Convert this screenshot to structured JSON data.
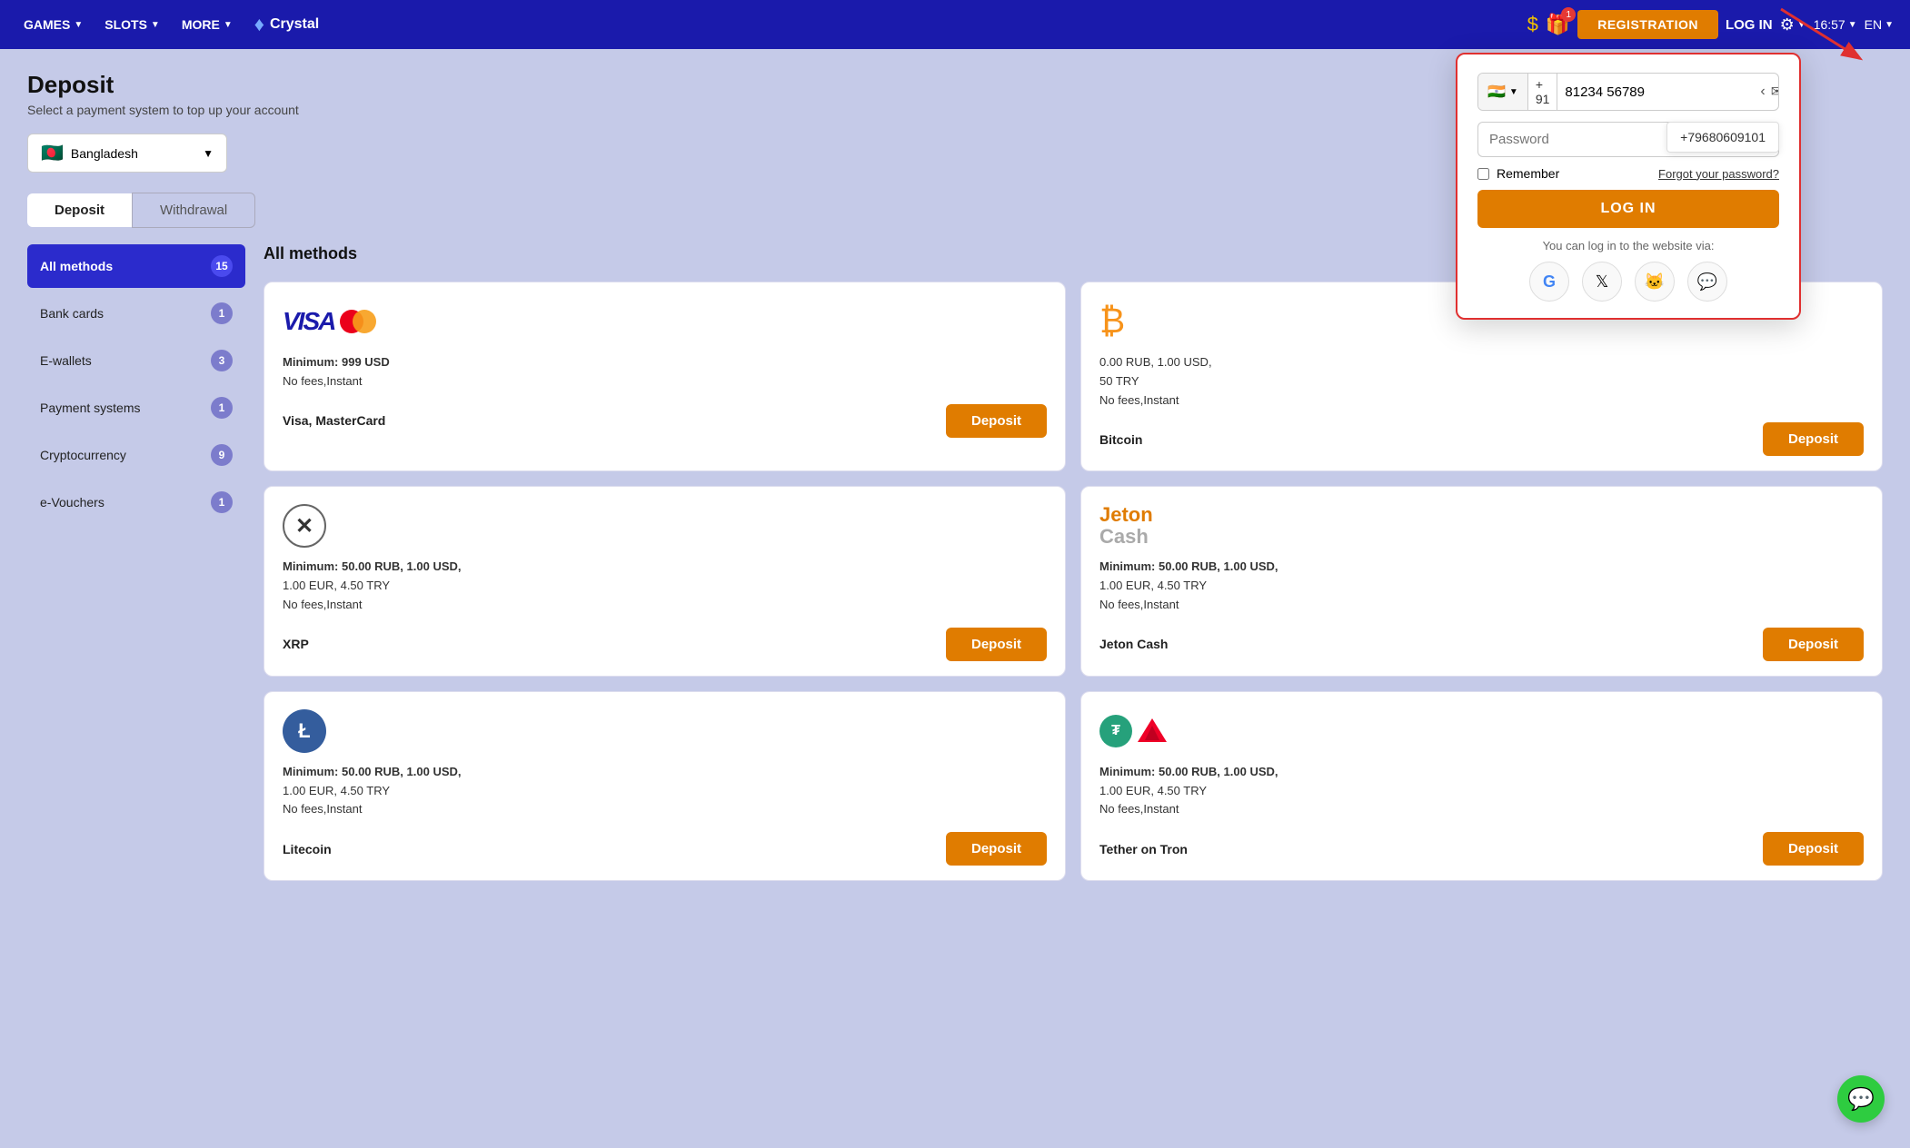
{
  "navbar": {
    "games_label": "GAMES",
    "slots_label": "SLOTS",
    "more_label": "MORE",
    "logo_icon": "♦",
    "logo_name": "Crystal",
    "registration_label": "REGISTRATION",
    "login_label": "LOG IN",
    "time": "16:57",
    "lang": "EN",
    "gift_badge": "1"
  },
  "page": {
    "title": "Deposit",
    "subtitle": "Select a payment system to top up your account",
    "country": "Bangladesh",
    "country_flag": "🇧🇩",
    "tab_deposit": "Deposit",
    "tab_withdrawal": "Withdrawal"
  },
  "sidebar": {
    "items": [
      {
        "id": "all-methods",
        "label": "All methods",
        "count": "15",
        "active": true
      },
      {
        "id": "bank-cards",
        "label": "Bank cards",
        "count": "1",
        "active": false
      },
      {
        "id": "e-wallets",
        "label": "E-wallets",
        "count": "3",
        "active": false
      },
      {
        "id": "payment-systems",
        "label": "Payment systems",
        "count": "1",
        "active": false
      },
      {
        "id": "cryptocurrency",
        "label": "Cryptocurrency",
        "count": "9",
        "active": false
      },
      {
        "id": "e-vouchers",
        "label": "e-Vouchers",
        "count": "1",
        "active": false
      }
    ]
  },
  "payment_section_title": "All methods",
  "payment_methods": [
    {
      "id": "visa-mastercard",
      "name": "Visa, MasterCard",
      "min": "Minimum: 999 USD",
      "fees": "No fees,Instant",
      "extra": "",
      "deposit_label": "Deposit"
    },
    {
      "id": "bitcoin",
      "name": "Bitcoin",
      "min": "0.00 RUB, 1.00 USD,",
      "fees": "No fees,Instant",
      "extra": "50 TRY",
      "deposit_label": "Deposit"
    },
    {
      "id": "xrp",
      "name": "XRP",
      "min": "Minimum: 50.00 RUB, 1.00 USD,",
      "fees": "No fees,Instant",
      "extra": "1.00 EUR, 4.50 TRY",
      "deposit_label": "Deposit"
    },
    {
      "id": "jeton-cash",
      "name": "Jeton Cash",
      "min": "Minimum: 50.00 RUB, 1.00 USD,",
      "fees": "No fees,Instant",
      "extra": "1.00 EUR, 4.50 TRY",
      "deposit_label": "Deposit"
    },
    {
      "id": "litecoin",
      "name": "Litecoin",
      "min": "Minimum: 50.00 RUB, 1.00 USD,",
      "fees": "No fees,Instant",
      "extra": "1.00 EUR, 4.50 TRY",
      "deposit_label": "Deposit"
    },
    {
      "id": "tether-on-tron",
      "name": "Tether on Tron",
      "min": "Minimum: 50.00 RUB, 1.00 USD,",
      "fees": "No fees,Instant",
      "extra": "1.00 EUR, 4.50 TRY",
      "deposit_label": "Deposit"
    }
  ],
  "login_modal": {
    "phone_flag": "🇮🇳",
    "phone_code": "+ 91",
    "phone_value": "81234 56789",
    "suggestion": "+79680609101",
    "password_placeholder": "Password",
    "remember_label": "Remember",
    "forgot_label": "Forgot your password?",
    "login_button": "LOG IN",
    "via_text": "You can log in to the website via:",
    "social_icons": [
      "G",
      "𝕏",
      "🐱",
      "💬"
    ]
  }
}
